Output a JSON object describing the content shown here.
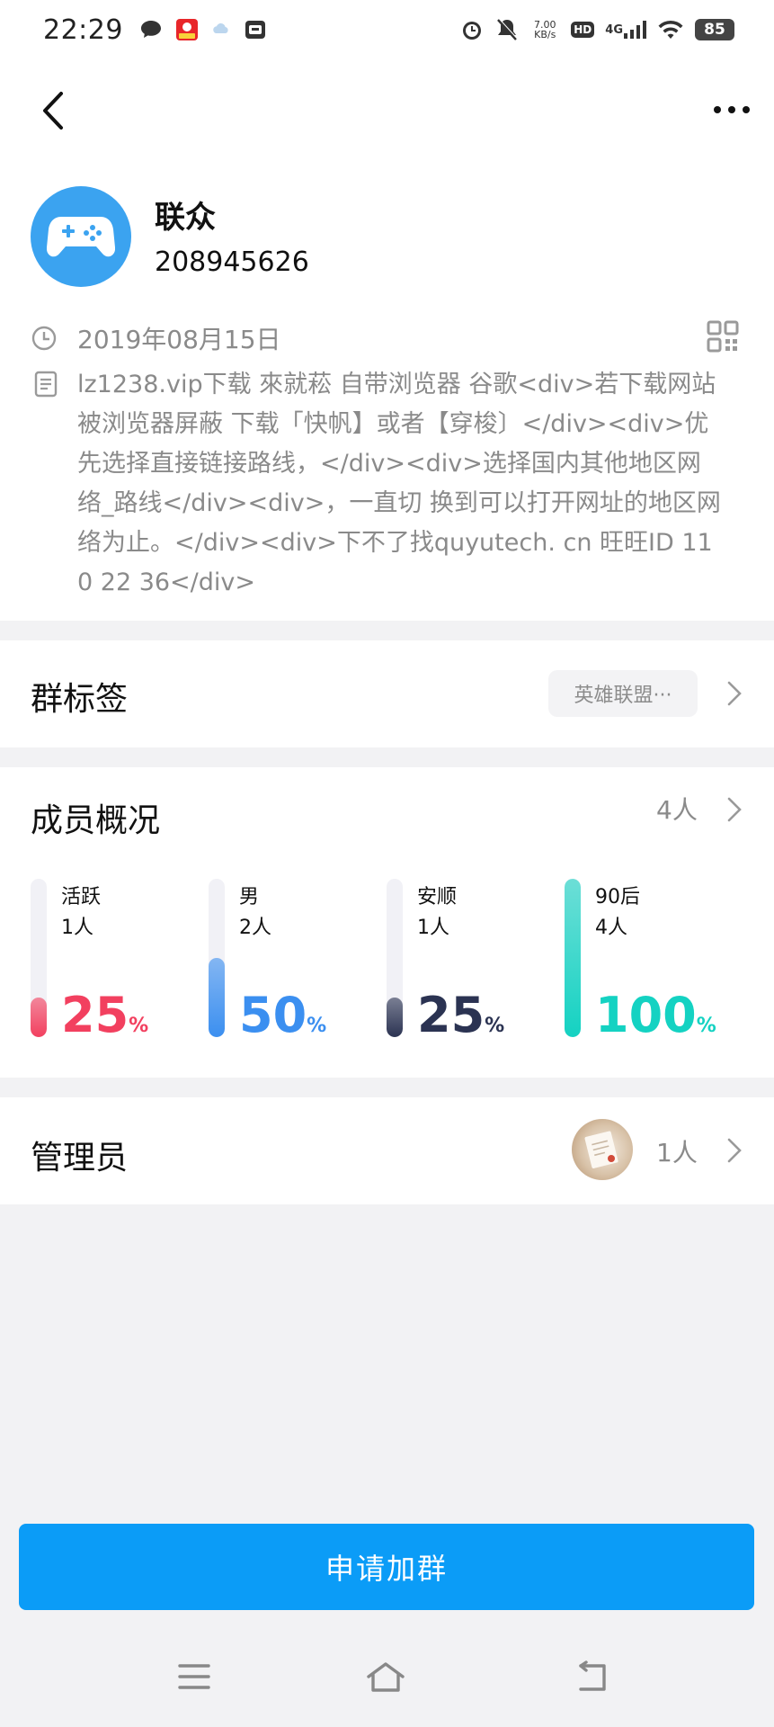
{
  "status_bar": {
    "time": "22:29",
    "net_speed_value": "7.00",
    "net_speed_unit": "KB/s",
    "hd_label": "HD",
    "network_label": "4G",
    "battery": "85",
    "left_icons": [
      "chat-bubble-icon",
      "taobao-app-icon",
      "weather-app-icon",
      "box-app-icon"
    ],
    "right_icons": [
      "alarm-icon",
      "mute-icon",
      "signal-icon",
      "wifi-icon",
      "battery-icon"
    ]
  },
  "nav": {
    "back_icon": "chevron-left-icon",
    "more_icon": "more-dots-icon"
  },
  "group": {
    "name": "联众",
    "id": "208945626",
    "avatar_icon": "gamepad-icon",
    "created_date": "2019年08月15日",
    "description": "lz1238.vip下载 來就菘 自带浏览器 谷歌<div>若下载网站被浏览器屏蔽 下载「快帆】或者【穿梭〕</div><div>优先选择直接链接路线，</div><div>选择国内其他地区网络_路线</div><div>，一直切 换到可以打开网址的地区网络为止。</div><div>下不了找quyutech. cn 旺旺ID 110 22 36</div>"
  },
  "tags": {
    "title": "群标签",
    "pill": "英雄联盟···"
  },
  "members": {
    "title": "成员概况",
    "count": "4人",
    "stats": [
      {
        "label": "活跃",
        "count": "1人",
        "percent": "25",
        "percent_sign": "%",
        "fraction": 0.25,
        "color": "#f2405f"
      },
      {
        "label": "男",
        "count": "2人",
        "percent": "50",
        "percent_sign": "%",
        "fraction": 0.5,
        "color": "#3b8ff0"
      },
      {
        "label": "安顺",
        "count": "1人",
        "percent": "25",
        "percent_sign": "%",
        "fraction": 0.25,
        "color": "#2b3352"
      },
      {
        "label": "90后",
        "count": "4人",
        "percent": "100",
        "percent_sign": "%",
        "fraction": 1.0,
        "color": "#14d2c2"
      }
    ]
  },
  "admin": {
    "title": "管理员",
    "count": "1人"
  },
  "join_button": "申请加群",
  "system_nav": {
    "menu_icon": "menu-icon",
    "home_icon": "home-icon",
    "back_icon": "back-icon"
  },
  "colors": {
    "accent": "#0b9cf7",
    "avatar_blue": "#3ba3f0",
    "muted_text": "#8a8a8a"
  }
}
